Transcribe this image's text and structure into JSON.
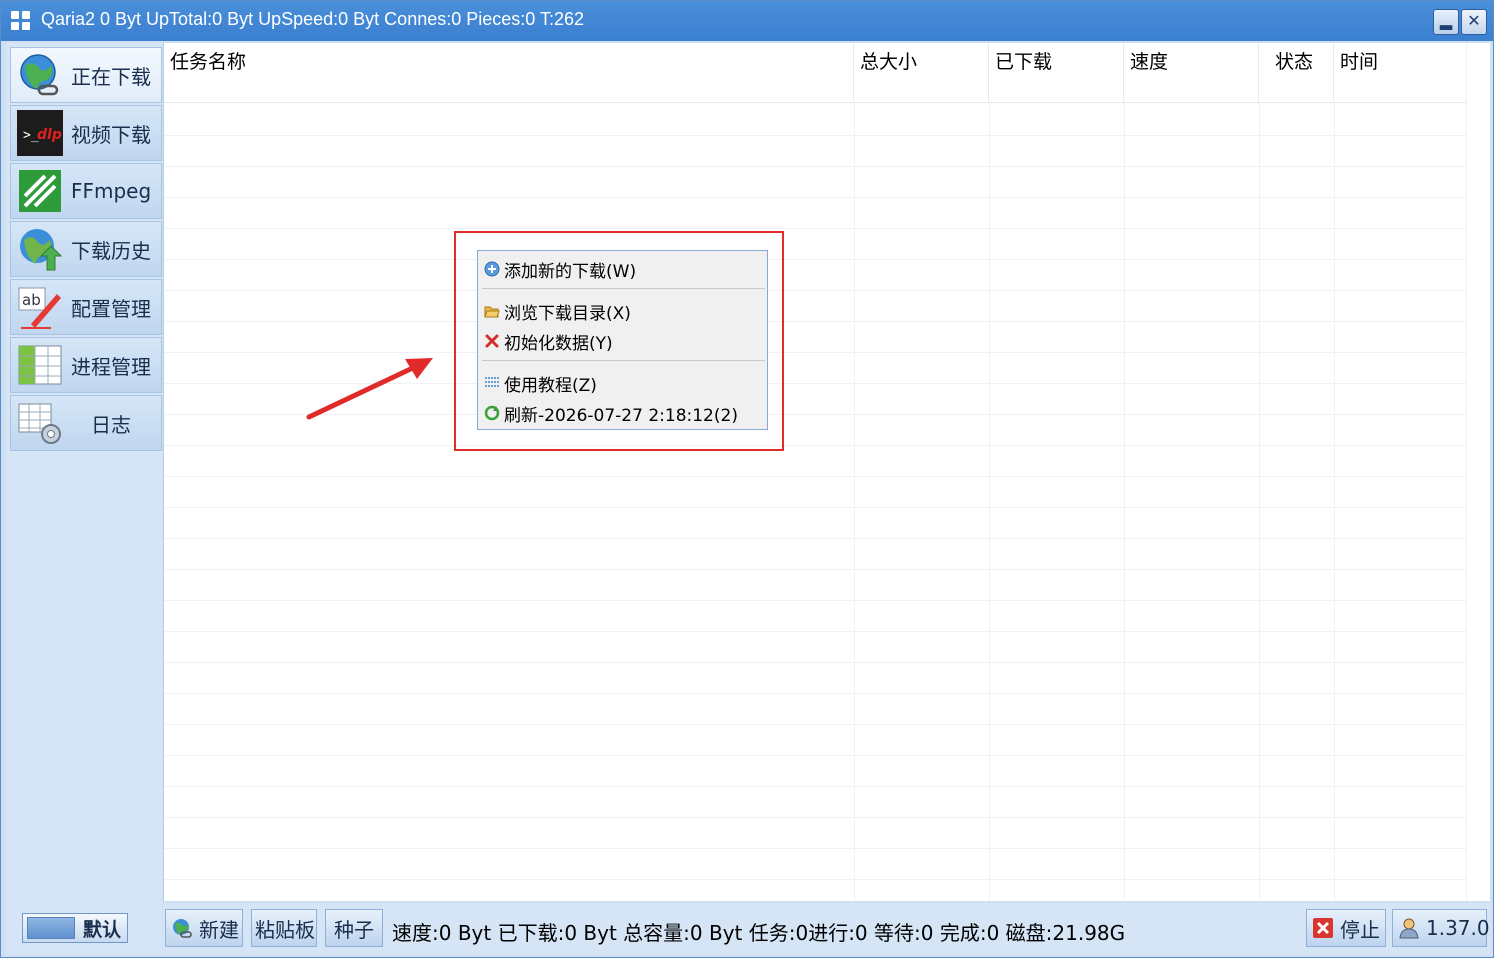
{
  "window": {
    "title": "Qaria2 0 Byt UpTotal:0 Byt UpSpeed:0 Byt Connes:0 Pieces:0 T:262"
  },
  "sidebar": {
    "items": [
      {
        "label": "正在下载",
        "icon": "globe-link-icon"
      },
      {
        "label": "视频下载",
        "icon": "ytdlp-icon"
      },
      {
        "label": "FFmpeg",
        "icon": "ffmpeg-icon"
      },
      {
        "label": "下载历史",
        "icon": "globe-upload-icon"
      },
      {
        "label": "配置管理",
        "icon": "edit-pen-icon"
      },
      {
        "label": "进程管理",
        "icon": "grid-table-icon"
      },
      {
        "label": "日志",
        "icon": "table-gear-icon"
      }
    ],
    "default_button": "默认"
  },
  "table": {
    "columns": [
      "任务名称",
      "总大小",
      "已下载",
      "速度",
      "状态",
      "时间"
    ]
  },
  "context_menu": {
    "items": [
      {
        "label": "添加新的下载(W)",
        "icon": "add-circle-icon"
      },
      {
        "label": "浏览下载目录(X)",
        "icon": "folder-open-icon"
      },
      {
        "label": "初始化数据(Y)",
        "icon": "red-x-icon"
      },
      {
        "label": "使用教程(Z)",
        "icon": "list-lines-icon"
      },
      {
        "label": "刷新-2026-07-27 2:18:12(2)",
        "icon": "refresh-icon"
      }
    ]
  },
  "statusbar": {
    "new_label": "新建",
    "paste_label": "粘贴板",
    "torrent_label": "种子",
    "status": "速度:0 Byt 已下载:0 Byt 总容量:0 Byt 任务:0进行:0 等待:0 完成:0 磁盘:21.98G",
    "stop_label": "停止",
    "version_label": "1.37.0"
  },
  "colors": {
    "titlebar": "#3b7fd0",
    "sidebar": "#d5e5f6",
    "highlight": "#e12b2b",
    "arrow": "#e12b2b"
  }
}
